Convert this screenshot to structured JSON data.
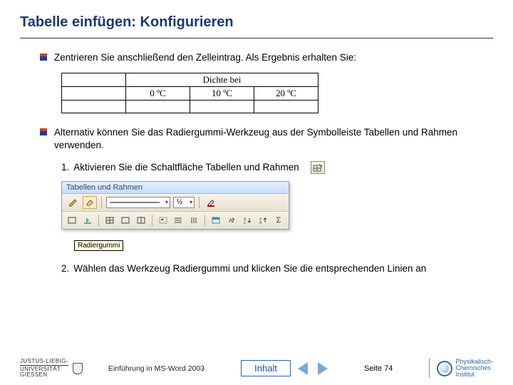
{
  "title": "Tabelle einfügen: Konfigurieren",
  "bullets": {
    "b1": "Zentrieren Sie anschließend den Zelleintrag. Als Ergebnis erhalten Sie:",
    "b2": "Alternativ können Sie das Radiergummi-Werkzeug aus der Symbolleiste Tabellen und Rahmen verwenden."
  },
  "table": {
    "header": "Dichte bei",
    "row2": {
      "c1": "0 ºC",
      "c2": "10 ºC",
      "c3": "20 ºC"
    },
    "row3": {
      "c1": "",
      "c2": "",
      "c3": ""
    }
  },
  "steps": {
    "s1": "Aktivieren Sie die Schaltfläche Tabellen und Rahmen",
    "s2": "Wählen das Werkzeug Radiergummi und klicken Sie die entsprechenden Linien an"
  },
  "toolbar": {
    "title": "Tabellen und Rahmen",
    "weight": "½",
    "tooltip": "Radiergummi"
  },
  "footer": {
    "uni1": "JUSTUS-LIEBIG-",
    "uni2": "UNIVERSITÄT",
    "uni3": "GIESSEN",
    "doc": "Einführung in MS-Word 2003",
    "inhalt": "Inhalt",
    "page": "Seite 74",
    "pci1": "Physikalisch-",
    "pci2": "Chemisches",
    "pci3": "Institut"
  }
}
